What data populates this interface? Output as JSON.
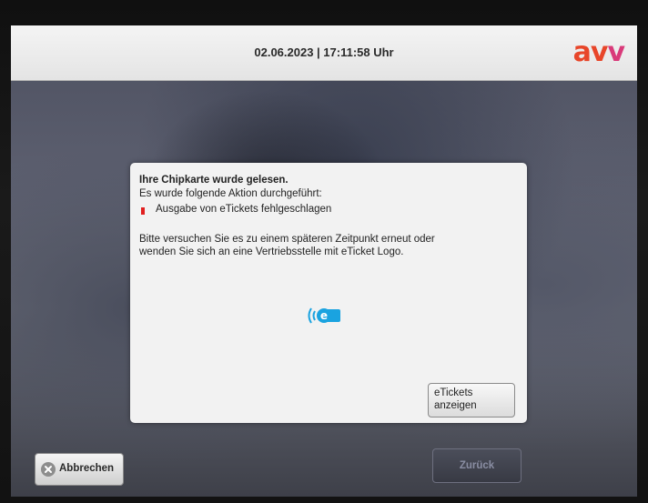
{
  "header": {
    "datetime": "02.06.2023 | 17:11:58 Uhr",
    "logo_a": "a",
    "logo_v1": "v",
    "logo_v2": "v"
  },
  "dialog": {
    "title": "Ihre Chipkarte wurde gelesen.",
    "line1": "Es wurde folgende Aktion durchgeführt:",
    "status": "Ausgabe von eTickets fehlgeschlagen",
    "message_line1": "Bitte versuchen Sie es zu einem späteren Zeitpunkt erneut oder",
    "message_line2": "wenden Sie sich an eine Vertriebsstelle mit eTicket Logo.",
    "icon": "eticket-icon",
    "etickets_button_line1": "eTickets",
    "etickets_button_line2": "anzeigen"
  },
  "footer": {
    "cancel_label": "Abbrechen",
    "back_label": "Zurück"
  },
  "colors": {
    "logo_primary": "#e8462a",
    "logo_secondary": "#d93a7a",
    "error_marker": "#e12020",
    "eticket_blue": "#1aa3e0"
  }
}
